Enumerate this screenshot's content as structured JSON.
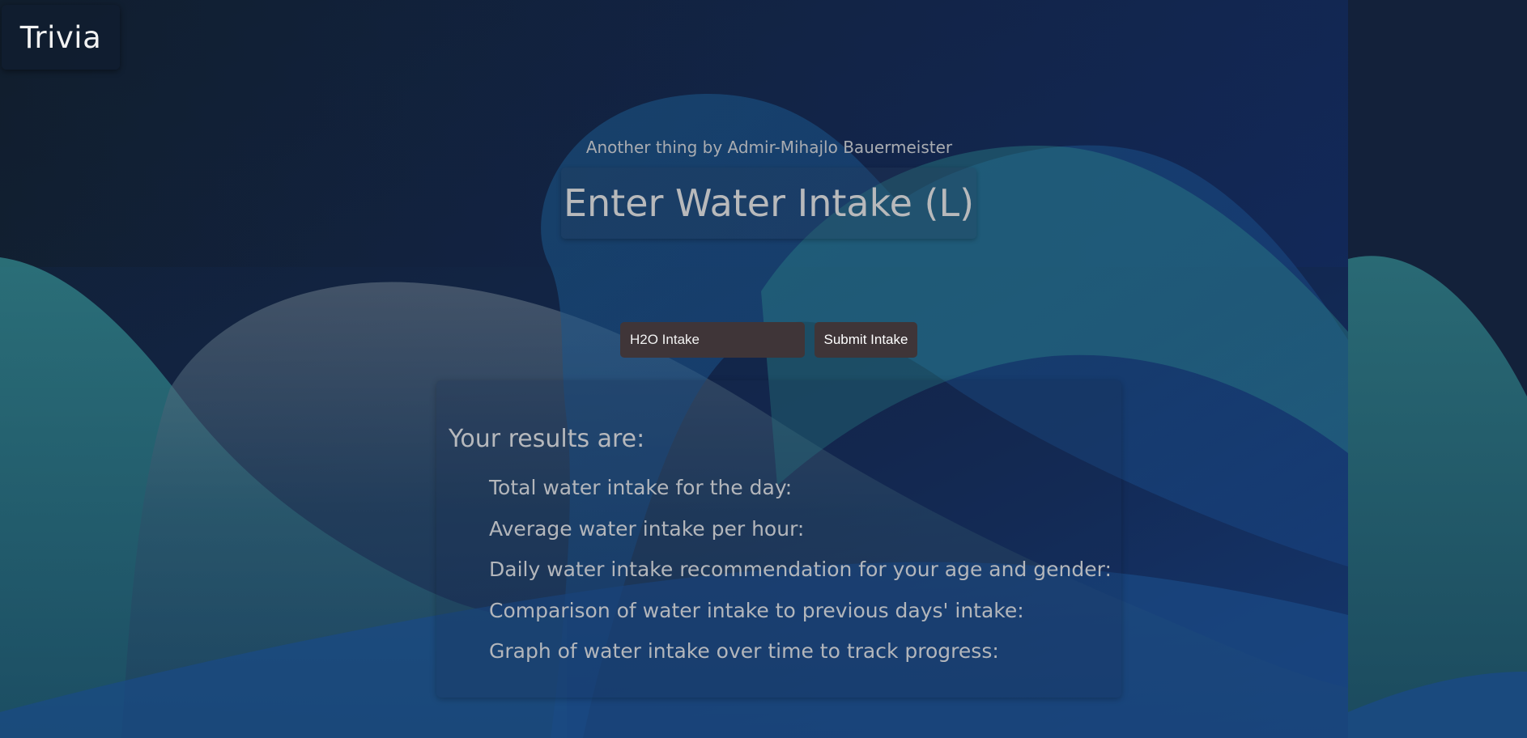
{
  "nav": {
    "brand": "Trivia"
  },
  "header": {
    "byline": "Another thing by Admir-Mihajlo Bauermeister",
    "title": "Enter Water Intake (L)"
  },
  "form": {
    "intake_placeholder": "H2O Intake",
    "submit_label": "Submit Intake"
  },
  "results": {
    "heading": "Your results are:",
    "items": [
      "Total water intake for the day:",
      "Average water intake per hour:",
      "Daily water intake recommendation for your age and gender:",
      "Comparison of water intake to previous days' intake:",
      "Graph of water intake over time to track progress:"
    ]
  },
  "colors": {
    "background": "#13213a",
    "wave_teal": "#2b7a80",
    "wave_blue": "#1a4a8a",
    "button_bg": "#3f3538"
  }
}
